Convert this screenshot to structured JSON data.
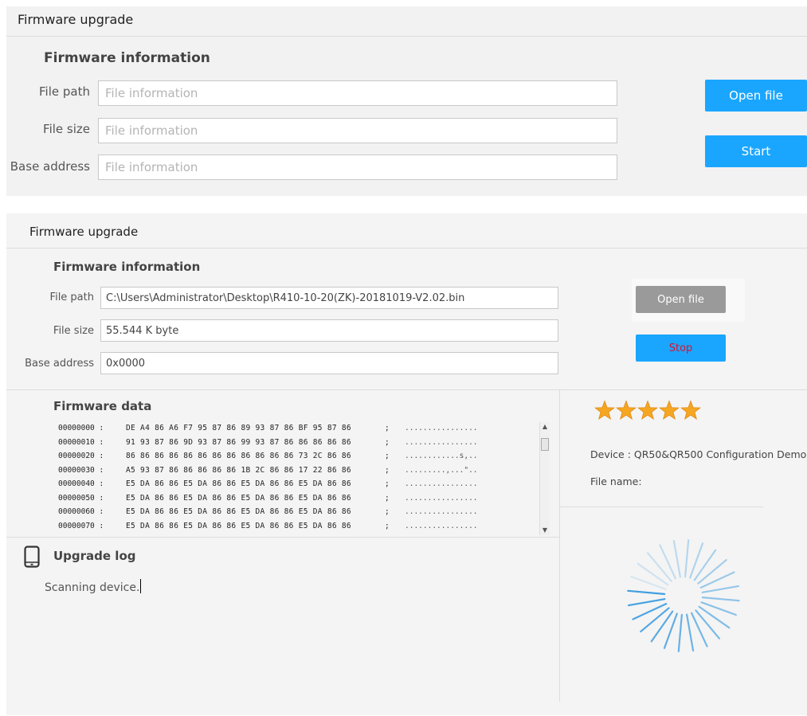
{
  "panel1": {
    "title": "Firmware upgrade",
    "section_title": "Firmware information",
    "file_path_label": "File path",
    "file_path_placeholder": "File information",
    "file_size_label": "File size",
    "file_size_placeholder": "File information",
    "base_address_label": "Base address",
    "base_address_placeholder": "File information",
    "open_file_label": "Open file",
    "start_label": "Start",
    "accent_color": "#1aa6ff"
  },
  "panel2": {
    "title": "Firmware upgrade",
    "section_title": "Firmware information",
    "file_path_label": "File path",
    "file_path_value": "C:\\Users\\Administrator\\Desktop\\R410-10-20(ZK)-20181019-V2.02.bin",
    "file_size_label": "File size",
    "file_size_value": "55.544 K byte",
    "base_address_label": "Base address",
    "base_address_value": "0x0000",
    "open_file_label": "Open file",
    "stop_label": "Stop",
    "firmware_data_title": "Firmware data",
    "hex_rows": [
      {
        "offset": "00000000 :",
        "bytes": "DE A4 86 A6 F7 95 87 86 89 93 87 86 BF 95 87 86",
        "colon": ";",
        "ascii": "................"
      },
      {
        "offset": "00000010 :",
        "bytes": "91 93 87 86 9D 93 87 86 99 93 87 86 86 86 86 86",
        "colon": ";",
        "ascii": "................"
      },
      {
        "offset": "00000020 :",
        "bytes": "86 86 86 86 86 86 86 86 86 86 86 86 73 2C 86 86",
        "colon": ";",
        "ascii": "............s,.."
      },
      {
        "offset": "00000030 :",
        "bytes": "A5 93 87 86 86 86 86 86 1B 2C 86 86 17 22 86 86",
        "colon": ";",
        "ascii": ".........,...\".."
      },
      {
        "offset": "00000040 :",
        "bytes": "E5 DA 86 86 E5 DA 86 86 E5 DA 86 86 E5 DA 86 86",
        "colon": ";",
        "ascii": "................"
      },
      {
        "offset": "00000050 :",
        "bytes": "E5 DA 86 86 E5 DA 86 86 E5 DA 86 86 E5 DA 86 86",
        "colon": ";",
        "ascii": "................"
      },
      {
        "offset": "00000060 :",
        "bytes": "E5 DA 86 86 E5 DA 86 86 E5 DA 86 86 E5 DA 86 86",
        "colon": ";",
        "ascii": "................"
      },
      {
        "offset": "00000070 :",
        "bytes": "E5 DA 86 86 E5 DA 86 86 E5 DA 86 86 E5 DA 86 86",
        "colon": ";",
        "ascii": "................"
      }
    ],
    "upgrade_log_title": "Upgrade log",
    "log_text": "Scanning device.",
    "device_text": "Device : QR50&QR500 Configuration Demo",
    "file_name_label": "File name:",
    "rating_stars": 5,
    "star_color": "#f5a623",
    "spinner_color": "#3a9be0",
    "disabled_button_color": "#9a9a9a",
    "stop_text_color": "#e0102a"
  }
}
